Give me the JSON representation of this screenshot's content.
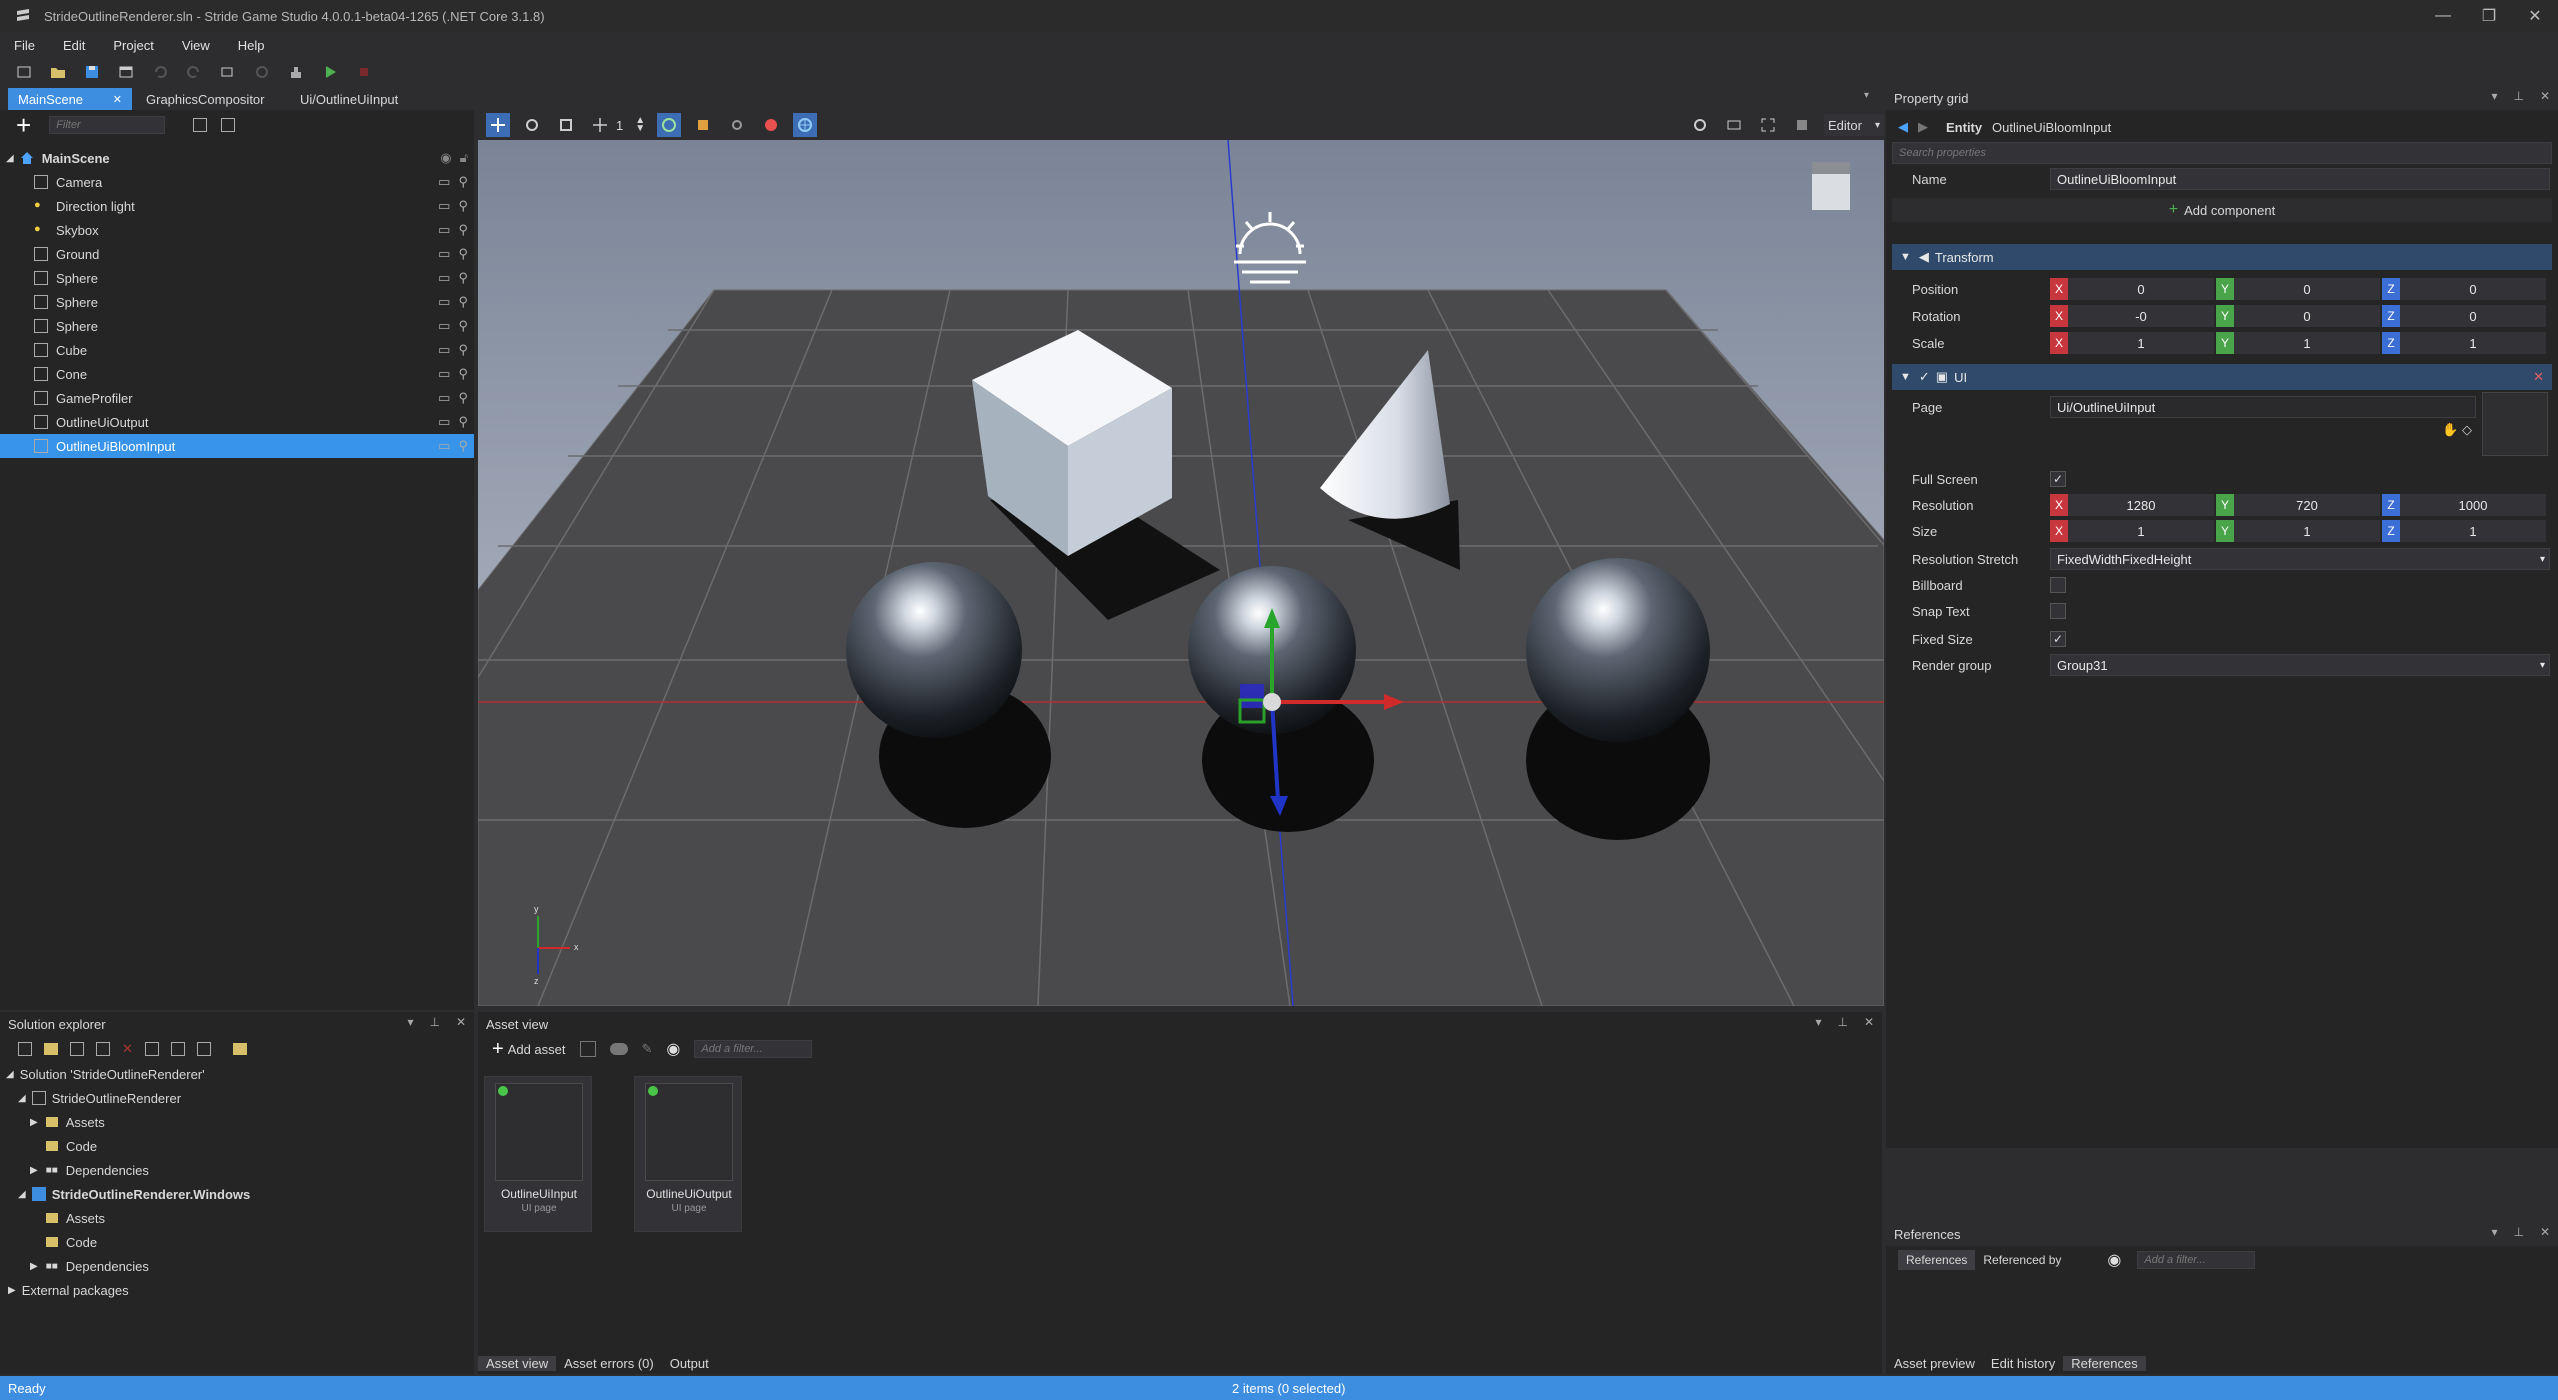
{
  "window": {
    "title": "StrideOutlineRenderer.sln - Stride Game Studio 4.0.0.1-beta04-1265 (.NET Core 3.1.8)",
    "minimize": "—",
    "maximize": "❐",
    "close": "✕"
  },
  "menu": [
    "File",
    "Edit",
    "Project",
    "View",
    "Help"
  ],
  "doc_tabs": [
    {
      "label": "MainScene",
      "active": true,
      "close": "✕"
    },
    {
      "label": "GraphicsCompositor",
      "active": false
    },
    {
      "label": "Ui/OutlineUiInput",
      "active": false
    }
  ],
  "scene_tree": {
    "filter_placeholder": "Filter",
    "root": "MainScene",
    "items": [
      "Camera",
      "Direction light",
      "Skybox",
      "Ground",
      "Sphere",
      "Sphere",
      "Sphere",
      "Cube",
      "Cone",
      "GameProfiler",
      "OutlineUiOutput",
      "OutlineUiBloomInput"
    ],
    "selected_index": 11
  },
  "viewport": {
    "snap_value": "1",
    "mode_select": "Editor",
    "axis_labels": {
      "x": "x",
      "y": "y",
      "z": "z"
    }
  },
  "solution_explorer": {
    "title": "Solution explorer",
    "solution": "Solution 'StrideOutlineRenderer'",
    "project1": "StrideOutlineRenderer",
    "project1_children": [
      "Assets",
      "Code",
      "Dependencies"
    ],
    "project2": "StrideOutlineRenderer.Windows",
    "project2_children": [
      "Assets",
      "Code",
      "Dependencies"
    ],
    "external": "External packages"
  },
  "asset_view": {
    "title": "Asset view",
    "add_asset": "Add asset",
    "filter_placeholder": "Add a filter...",
    "assets": [
      {
        "name": "OutlineUiInput",
        "type": "UI page"
      },
      {
        "name": "OutlineUiOutput",
        "type": "UI page"
      }
    ],
    "bottom_tabs": [
      "Asset view",
      "Asset errors (0)",
      "Output"
    ]
  },
  "property_grid": {
    "title": "Property grid",
    "entity_prefix": "Entity",
    "entity_name": "OutlineUiBloomInput",
    "search_placeholder": "Search properties",
    "name_label": "Name",
    "name_value": "OutlineUiBloomInput",
    "add_component": "Add component",
    "transform": {
      "title": "Transform",
      "rows": [
        {
          "label": "Position",
          "x": "0",
          "y": "0",
          "z": "0"
        },
        {
          "label": "Rotation",
          "x": "-0",
          "y": "0",
          "z": "0"
        },
        {
          "label": "Scale",
          "x": "1",
          "y": "1",
          "z": "1"
        }
      ]
    },
    "ui": {
      "title": "UI",
      "page_label": "Page",
      "page_value": "Ui/OutlineUiInput",
      "full_screen_label": "Full Screen",
      "full_screen": true,
      "resolution": {
        "label": "Resolution",
        "x": "1280",
        "y": "720",
        "z": "1000"
      },
      "size": {
        "label": "Size",
        "x": "1",
        "y": "1",
        "z": "1"
      },
      "stretch_label": "Resolution Stretch",
      "stretch_value": "FixedWidthFixedHeight",
      "billboard_label": "Billboard",
      "billboard": false,
      "snap_text_label": "Snap Text",
      "snap_text": false,
      "fixed_size_label": "Fixed Size",
      "fixed_size": true,
      "render_group_label": "Render group",
      "render_group_value": "Group31"
    },
    "axis": {
      "x": "X",
      "y": "Y",
      "z": "Z"
    }
  },
  "references": {
    "title": "References",
    "tab_references": "References",
    "tab_referenced_by": "Referenced by",
    "filter_placeholder": "Add a filter...",
    "bottom_tabs": [
      "Asset preview",
      "Edit history",
      "References"
    ]
  },
  "status": {
    "left": "Ready",
    "center": "2 items (0 selected)"
  },
  "colors": {
    "accent": "#3d8ee0",
    "selection": "#3794e8",
    "axis_x": "#c8373d",
    "axis_y": "#4aa54a",
    "axis_z": "#3b6fd6"
  }
}
